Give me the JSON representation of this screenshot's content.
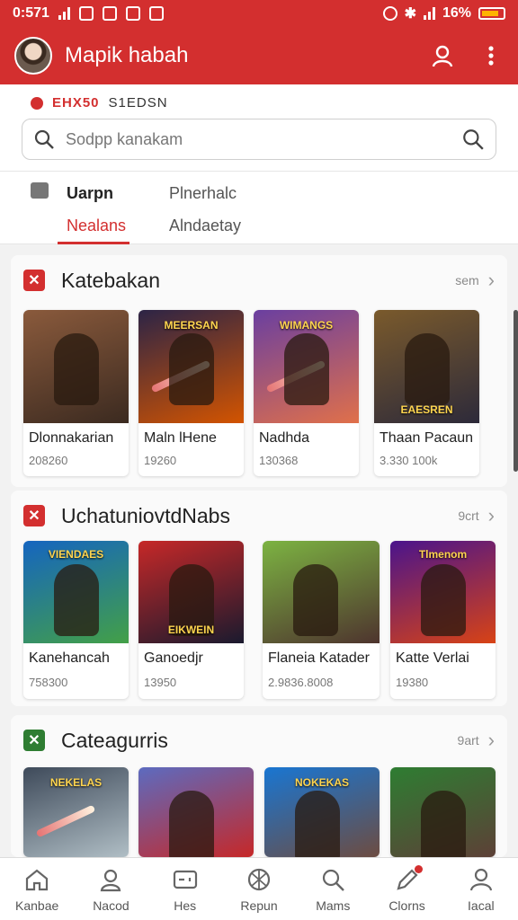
{
  "status": {
    "time": "0:571",
    "battery": "16%"
  },
  "app": {
    "title": "Mapik habah"
  },
  "promo": {
    "code": "EHX50",
    "text": "S1EDSN"
  },
  "search": {
    "placeholder": "Sodpp kanakam"
  },
  "tabs": [
    {
      "label": "Uarpn"
    },
    {
      "label": "Plnerhalc"
    },
    {
      "label": "Nealans"
    },
    {
      "label": "Alndaetay"
    }
  ],
  "sections": [
    {
      "title": "Katebakan",
      "more": "sem",
      "badge_color": "#d32f2f",
      "items": [
        {
          "name": "Dlonnakarian",
          "count": "208260",
          "thumb_text": "",
          "colors": [
            "#8a5a3c",
            "#3b2a20"
          ]
        },
        {
          "name": "Maln lHene",
          "count": "19260",
          "thumb_text": "MEERSAN",
          "colors": [
            "#2c2446",
            "#d35400"
          ]
        },
        {
          "name": "Nadhda",
          "count": "130368",
          "thumb_text": "WIMANGS",
          "colors": [
            "#6a3fa0",
            "#e0704a"
          ]
        },
        {
          "name": "Thaan Pacaun",
          "count": "3.330 100k",
          "thumb_text": "EAESREN",
          "colors": [
            "#7a5a2c",
            "#2d2a3a"
          ]
        }
      ]
    },
    {
      "title": "UchatuniovtdNabs",
      "more": "9crt",
      "badge_color": "#d32f2f",
      "items": [
        {
          "name": "Kanehancah",
          "count": "758300",
          "thumb_text": "VIENDAES",
          "colors": [
            "#1565c0",
            "#43a047"
          ]
        },
        {
          "name": "Ganoedjr",
          "count": "13950",
          "thumb_text": "EIKWEIN",
          "colors": [
            "#c62828",
            "#1a1a2e"
          ]
        },
        {
          "name": "Flaneia Katader",
          "count": "2.9836.8008",
          "thumb_text": "",
          "colors": [
            "#7cb342",
            "#4e342e"
          ]
        },
        {
          "name": "Katte Verlai",
          "count": "19380",
          "thumb_text": "Tlmenom",
          "colors": [
            "#4a148c",
            "#d84315"
          ]
        }
      ]
    },
    {
      "title": "Cateagurris",
      "more": "9art",
      "badge_color": "#2e7d32",
      "items": [
        {
          "name": "",
          "count": "",
          "thumb_text": "NEKELAS",
          "colors": [
            "#3e4a5a",
            "#b0bec5"
          ]
        },
        {
          "name": "",
          "count": "",
          "thumb_text": "",
          "colors": [
            "#5c6bc0",
            "#c62828"
          ]
        },
        {
          "name": "",
          "count": "",
          "thumb_text": "NOKEKAS",
          "colors": [
            "#1976d2",
            "#6d4c41"
          ]
        },
        {
          "name": "",
          "count": "",
          "thumb_text": "",
          "colors": [
            "#2e7d32",
            "#5d4037"
          ]
        }
      ]
    }
  ],
  "bottom_nav": [
    {
      "label": "Kanbae",
      "icon": "home-icon"
    },
    {
      "label": "Nacod",
      "icon": "user-badge-icon"
    },
    {
      "label": "Hes",
      "icon": "controller-icon"
    },
    {
      "label": "Repun",
      "icon": "globe-icon"
    },
    {
      "label": "Mams",
      "icon": "search-icon"
    },
    {
      "label": "Clorns",
      "icon": "edit-icon"
    },
    {
      "label": "Iacal",
      "icon": "profile-icon"
    }
  ]
}
